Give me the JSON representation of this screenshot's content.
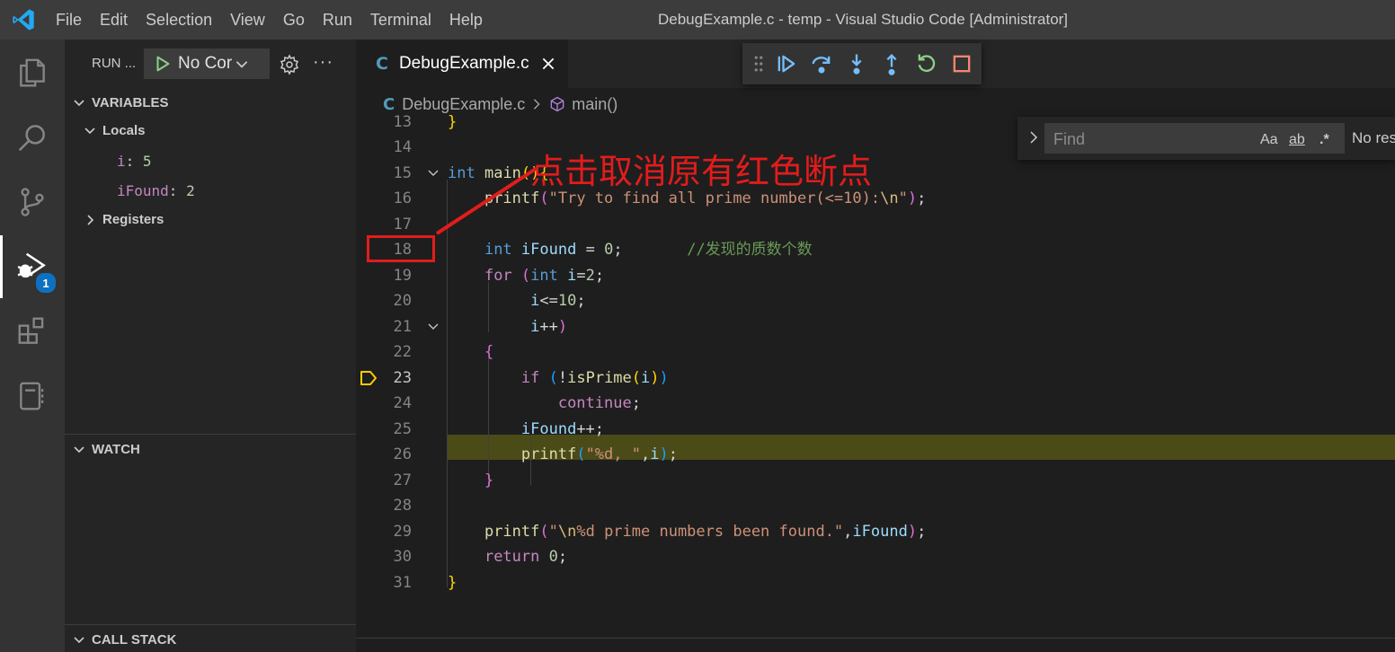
{
  "titlebar": {
    "menu": [
      "File",
      "Edit",
      "Selection",
      "View",
      "Go",
      "Run",
      "Terminal",
      "Help"
    ],
    "window_title": "DebugExample.c - temp - Visual Studio Code [Administrator]"
  },
  "activitybar": {
    "items": [
      "explorer-icon",
      "search-icon",
      "source-control-icon",
      "run-debug-icon",
      "extensions-icon",
      "notebook-icon"
    ],
    "active": "run-debug-icon",
    "debug_badge": "1"
  },
  "sidebar": {
    "run_label": "RUN ...",
    "config_name": "No Cor",
    "variables_title": "VARIABLES",
    "locals_label": "Locals",
    "variables": [
      {
        "name": "i",
        "value": "5"
      },
      {
        "name": "iFound",
        "value": "2"
      }
    ],
    "registers_label": "Registers",
    "watch_title": "WATCH",
    "callstack_title": "CALL STACK"
  },
  "editor": {
    "tab_label": "DebugExample.c",
    "tab_file_icon": "C",
    "breadcrumb": {
      "file": "DebugExample.c",
      "symbol": "main()"
    },
    "find": {
      "placeholder": "Find",
      "opt_case": "Aa",
      "opt_word": "ab",
      "opt_regex": ".*",
      "result": "No res"
    },
    "current_line": "23",
    "line_numbers": [
      "13",
      "14",
      "15",
      "16",
      "17",
      "18",
      "19",
      "20",
      "21",
      "22",
      "23",
      "24",
      "25",
      "26",
      "27",
      "28",
      "29",
      "30",
      "31"
    ],
    "comment_text": "//发现的质数个数"
  },
  "annotation": {
    "text": "点击取消原有红色断点",
    "color": "#e21c1c"
  },
  "colors": {
    "accent": "#0e70c0",
    "current_line": "#4b4b18",
    "debug_arrow": "#ffcc00"
  }
}
